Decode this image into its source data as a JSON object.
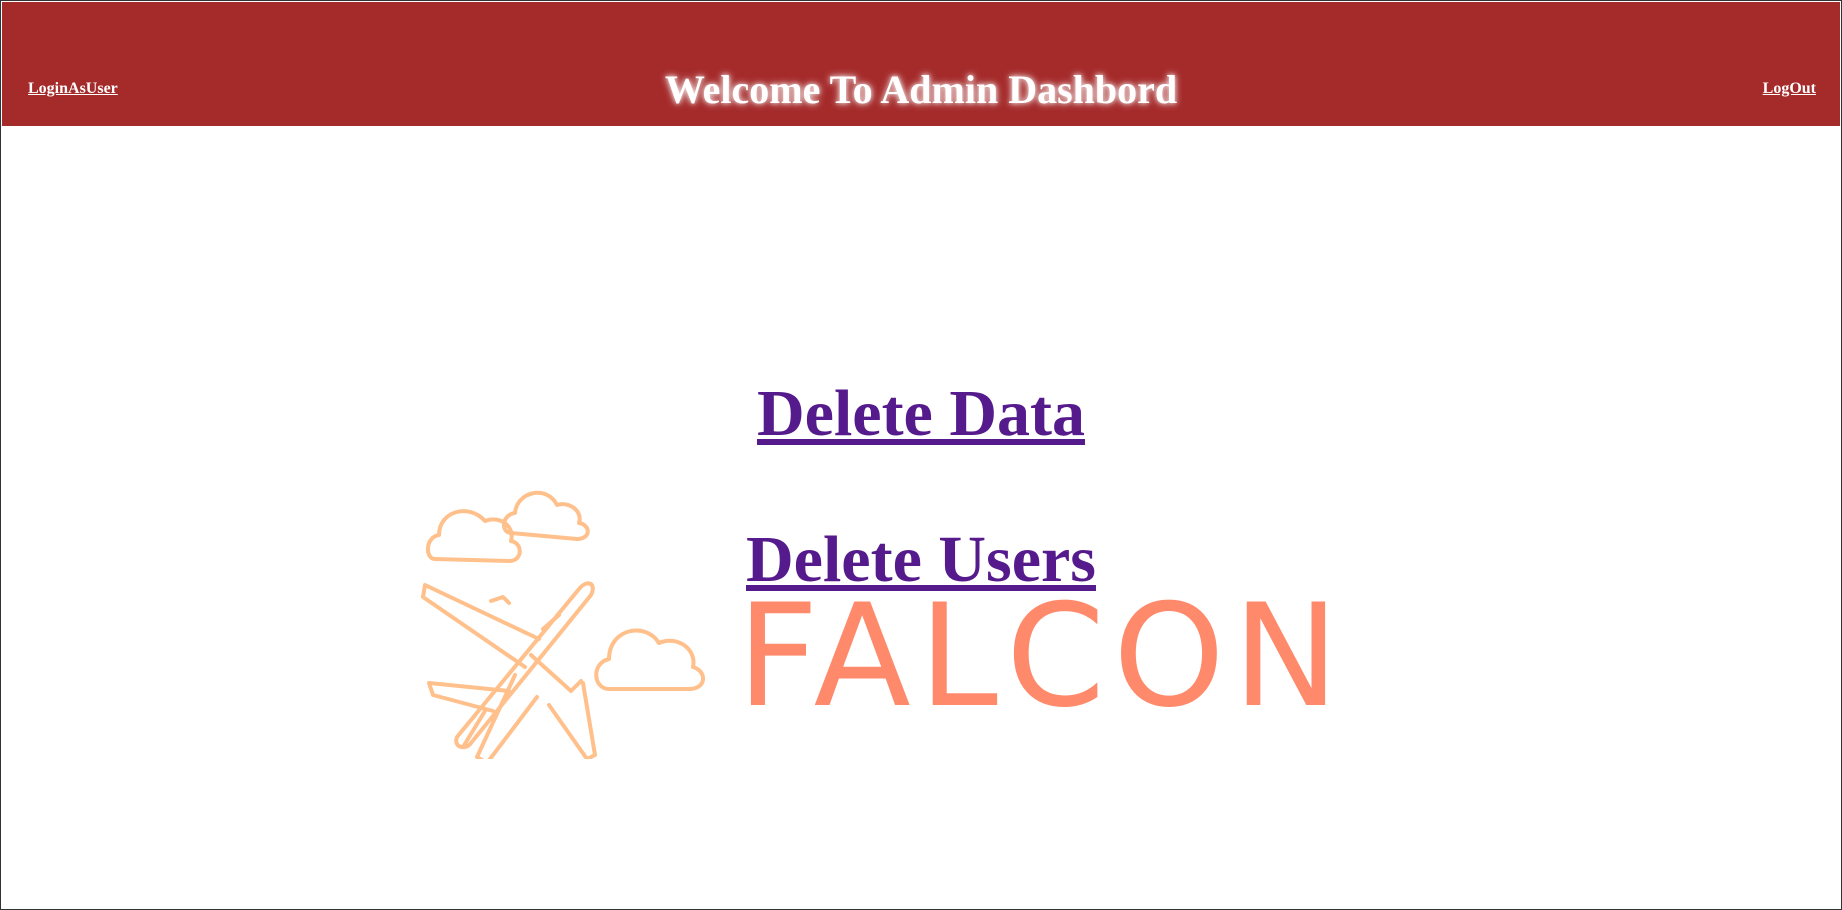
{
  "header": {
    "title": "Welcome To Admin Dashbord",
    "left_link": "LoginAsUser",
    "right_link": "LogOut",
    "background_color": "#a52a2a"
  },
  "main": {
    "actions": [
      {
        "label": "Delete Data"
      },
      {
        "label": "Delete Users"
      }
    ],
    "link_color": "#551a8b"
  },
  "logo": {
    "text": "FALCON",
    "icon": "airplane-with-clouds-icon",
    "colors": {
      "text": "#ff8a6b",
      "outline": "#ffc08c"
    }
  }
}
